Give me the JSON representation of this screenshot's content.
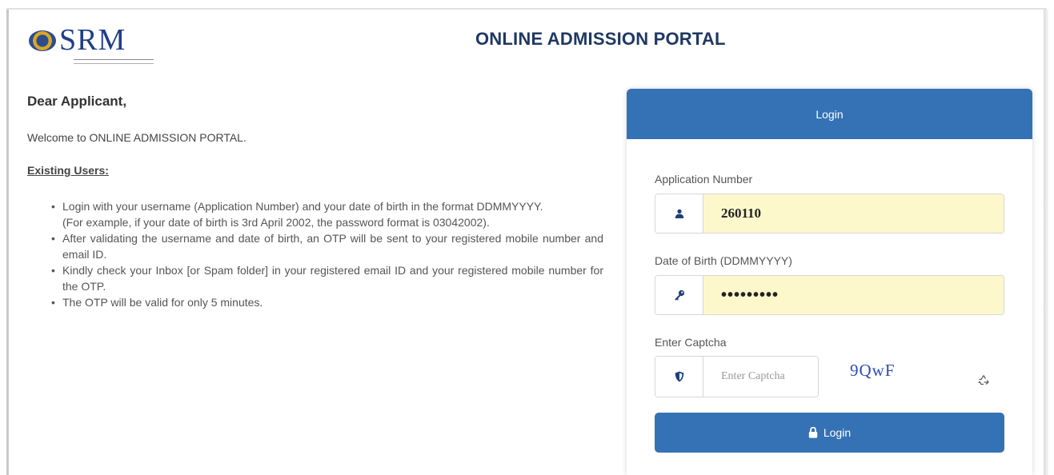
{
  "header": {
    "logo_text": "SRM",
    "title": "ONLINE ADMISSION PORTAL"
  },
  "info": {
    "greeting": "Dear Applicant,",
    "welcome": "Welcome to ONLINE ADMISSION PORTAL.",
    "existing_users_heading": "Existing Users:",
    "bullets": [
      {
        "text": "Login with your username (Application Number) and your date of birth in the format DDMMYYYY.",
        "note": "(For example, if your date of birth is 3rd April 2002, the password format is 03042002)."
      },
      {
        "text": "After validating the username and date of birth, an OTP will be sent to your registered mobile number and email ID."
      },
      {
        "text": "Kindly check your Inbox [or Spam folder] in your registered email ID and your registered mobile number for the OTP."
      },
      {
        "text": "The OTP will be valid for only 5 minutes."
      }
    ]
  },
  "login_card": {
    "header": "Login",
    "application_number": {
      "label": "Application Number",
      "value": "260110",
      "icon": "user-icon"
    },
    "dob": {
      "label": "Date of Birth (DDMMYYYY)",
      "value": "•••••••••",
      "icon": "key-icon"
    },
    "captcha": {
      "label": "Enter Captcha",
      "placeholder": "Enter Captcha",
      "value": "",
      "icon": "shield-icon",
      "challenge_text": "9QwF",
      "refresh_icon": "refresh-icon"
    },
    "login_button": "Login",
    "login_button_icon": "lock-icon"
  },
  "colors": {
    "primary": "#3572b5",
    "title": "#1f3864",
    "autofill": "#fcf8cc",
    "captcha_text": "#2c4cb8"
  }
}
